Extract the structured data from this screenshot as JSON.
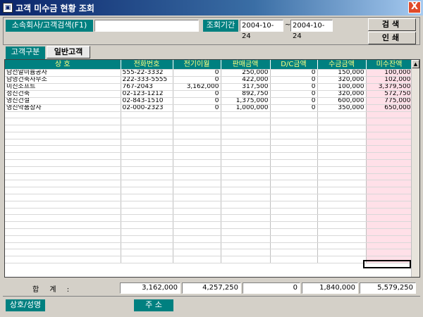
{
  "window": {
    "title": "고객 미수금 현황 조회",
    "close_glyph": "X"
  },
  "filters": {
    "customer_label": "소속회사/고객검색(F1)",
    "customer_value": "",
    "period_label": "조회기간",
    "date_from": "2004-10-24",
    "date_sep": "~",
    "date_to": "2004-10-24"
  },
  "buttons": {
    "search": "검색",
    "print": "인쇄"
  },
  "tabs": {
    "group_label": "고객구분",
    "active": "일반고객"
  },
  "grid": {
    "columns": [
      "상  호",
      "전화번호",
      "전기이월",
      "판매금액",
      "D/C금액",
      "수금금액",
      "미수잔액"
    ],
    "rows": [
      [
        "남선알미늄공사",
        "555-22-3332",
        "0",
        "250,000",
        "0",
        "150,000",
        "100,000"
      ],
      [
        "남영건축사무소",
        "222-333-5555",
        "0",
        "422,000",
        "0",
        "320,000",
        "102,000"
      ],
      [
        "미진소프트",
        "767-2043",
        "3,162,000",
        "317,500",
        "0",
        "100,000",
        "3,379,500"
      ],
      [
        "성진건축",
        "02-123-1212",
        "0",
        "892,750",
        "0",
        "320,000",
        "572,750"
      ],
      [
        "영진건설",
        "02-843-1510",
        "0",
        "1,375,000",
        "0",
        "600,000",
        "775,000"
      ],
      [
        "영진약품상사",
        "02-000-2323",
        "0",
        "1,000,000",
        "0",
        "350,000",
        "650,000"
      ]
    ]
  },
  "totals": {
    "label": "합 계 :",
    "carry_over": "3,162,000",
    "sales": "4,257,250",
    "dc": "0",
    "collected": "1,840,000",
    "balance": "5,579,250"
  },
  "footer": {
    "name_label": "상호/성명",
    "address_label": "주    소"
  },
  "colors": {
    "label_bg": "#008080",
    "header_text": "#ffff80",
    "balance_col_bg": "#ffe0e8"
  }
}
